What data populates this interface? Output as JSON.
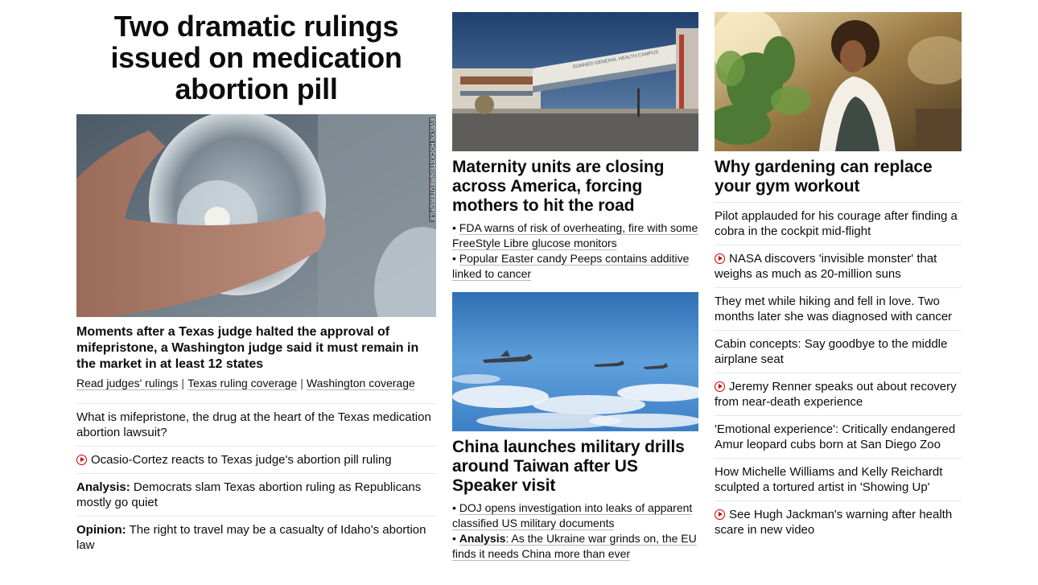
{
  "left": {
    "headline": "Two dramatic rulings issued on medication abortion pill",
    "image_credit": "EVELYN HOCKSTEIN/REUTERS/FILE",
    "story_title": "Moments after a Texas judge halted the approval of mifepristone, a Washington judge said it must remain in the market in at least 12 states",
    "related_links": [
      "Read judges' rulings",
      "Texas ruling coverage",
      "Washington coverage"
    ],
    "list": [
      {
        "text": "What is mifepristone, the drug at the heart of the Texas medication abortion lawsuit?"
      },
      {
        "text": "Ocasio-Cortez reacts to Texas judge's abortion pill ruling",
        "video": true
      },
      {
        "label": "Analysis:",
        "text": "Democrats slam Texas abortion ruling as Republicans mostly go quiet"
      },
      {
        "label": "Opinion:",
        "text": "The right to travel may be a casualty of Idaho's abortion law"
      }
    ]
  },
  "middle": {
    "story1": {
      "sign_text": "SUMNER GENERAL HEALTH CAMPUS",
      "title": "Maternity units are closing across America, forcing mothers to hit the road",
      "bullets": [
        {
          "text": "FDA warns of risk of overheating, fire with some FreeStyle Libre glucose monitors"
        },
        {
          "text": "Popular Easter candy Peeps contains additive linked to cancer"
        }
      ]
    },
    "story2": {
      "title": "China launches military drills around Taiwan after US Speaker visit",
      "bullets": [
        {
          "text": "DOJ opens investigation into leaks of apparent classified US military documents"
        },
        {
          "label": "Analysis",
          "text": ": As the Ukraine war grinds on, the EU finds it needs China more than ever"
        }
      ]
    }
  },
  "right": {
    "title": "Why gardening can replace your gym workout",
    "list": [
      {
        "text": "Pilot applauded for his courage after finding a cobra in the cockpit mid-flight"
      },
      {
        "text": "NASA discovers 'invisible monster' that weighs as much as 20-million suns",
        "video": true
      },
      {
        "text": "They met while hiking and fell in love. Two months later she was diagnosed with cancer"
      },
      {
        "text": "Cabin concepts: Say goodbye to the middle airplane seat"
      },
      {
        "text": "Jeremy Renner speaks out about recovery from near-death experience",
        "video": true
      },
      {
        "text": "'Emotional experience': Critically endangered Amur leopard cubs born at San Diego Zoo"
      },
      {
        "text": "How Michelle Williams and Kelly Reichardt sculpted a tortured artist in 'Showing Up'"
      },
      {
        "text": "See Hugh Jackman's warning after health scare in new video",
        "video": true
      }
    ]
  },
  "colors": {
    "accent_red": "#cc0000",
    "text": "#0c0c0c",
    "divider": "#e6e6e6"
  }
}
